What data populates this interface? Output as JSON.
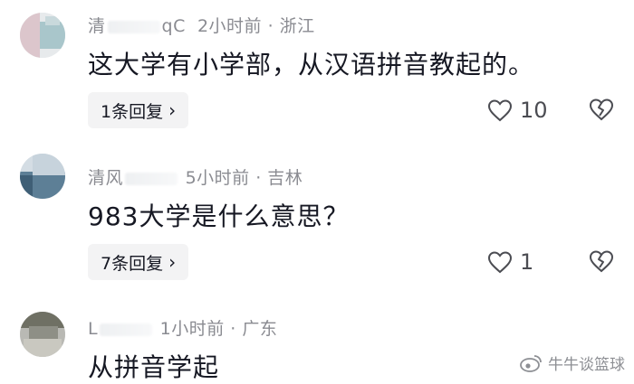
{
  "comments": [
    {
      "username": "清",
      "username_tail": "qC",
      "time": "2小时前",
      "location": "浙江",
      "text": "这大学有小学部，从汉语拼音教起的。",
      "replies": "1条回复",
      "likes": "10"
    },
    {
      "username": "清风",
      "username_tail": "",
      "time": "5小时前",
      "location": "吉林",
      "text": "983大学是什么意思？",
      "replies": "7条回复",
      "likes": "1"
    },
    {
      "username": "L",
      "username_tail": "",
      "time": "1小时前",
      "location": "广东",
      "text": "从拼音学起"
    }
  ],
  "separator": "·",
  "chevron": "›",
  "watermark": "牛牛谈篮球",
  "icons": {
    "like": "heart-outline-icon",
    "dislike": "broken-heart-icon",
    "watermark": "weibo-icon"
  },
  "colors": {
    "text": "#161823",
    "meta": "#8a8b91",
    "pill_bg": "#f3f3f4"
  }
}
